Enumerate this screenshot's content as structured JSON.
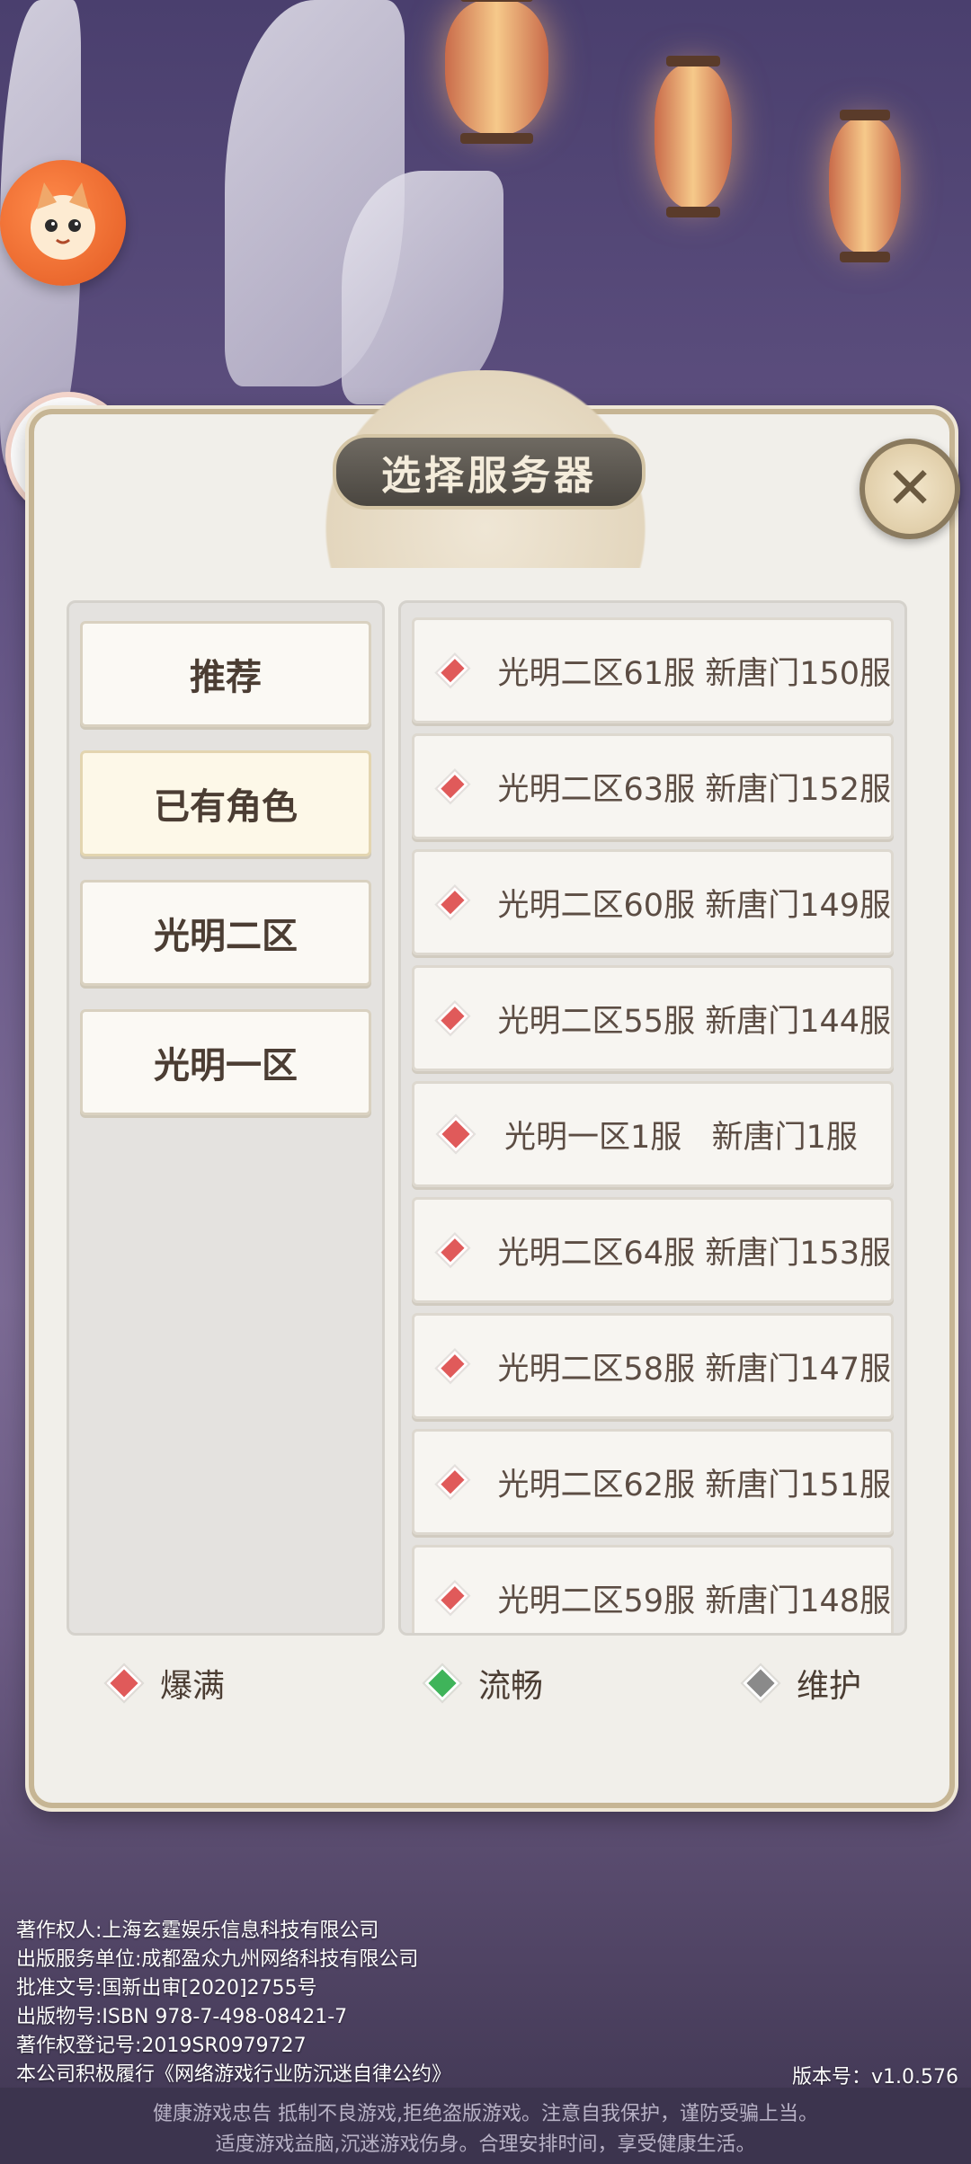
{
  "dialog": {
    "title": "选择服务器",
    "close_label": "✕"
  },
  "tabs": [
    "推荐",
    "已有角色",
    "光明二区",
    "光明一区"
  ],
  "servers": [
    "光明二区61服 新唐门150服",
    "光明二区63服 新唐门152服",
    "光明二区60服 新唐门149服",
    "光明二区55服 新唐门144服",
    "光明一区1服   新唐门1服",
    "光明二区64服 新唐门153服",
    "光明二区58服 新唐门147服",
    "光明二区62服 新唐门151服",
    "光明二区59服 新唐门148服"
  ],
  "legend": {
    "full": "爆满",
    "smooth": "流畅",
    "maintenance": "维护"
  },
  "colors": {
    "full": "#e05a5a",
    "smooth": "#3fb45a",
    "maintenance": "#8a8a8a"
  },
  "icons": {
    "left_top": "cat-mascot-icon",
    "left_mid": "rocket-icon"
  },
  "copyright": {
    "line1": "著作权人:上海玄霆娱乐信息科技有限公司",
    "line2": "出版服务单位:成都盈众九州网络科技有限公司",
    "line3": "批准文号:国新出审[2020]2755号",
    "line4": "出版物号:ISBN 978-7-498-08421-7",
    "line5": "著作权登记号:2019SR0979727",
    "line6": "本公司积极履行《网络游戏行业防沉迷自律公约》"
  },
  "version": "版本号：v1.0.576",
  "health": {
    "line1": "健康游戏忠告    抵制不良游戏,拒绝盗版游戏。注意自我保护，谨防受骗上当。",
    "line2": "适度游戏益脑,沉迷游戏伤身。合理安排时间，享受健康生活。"
  }
}
